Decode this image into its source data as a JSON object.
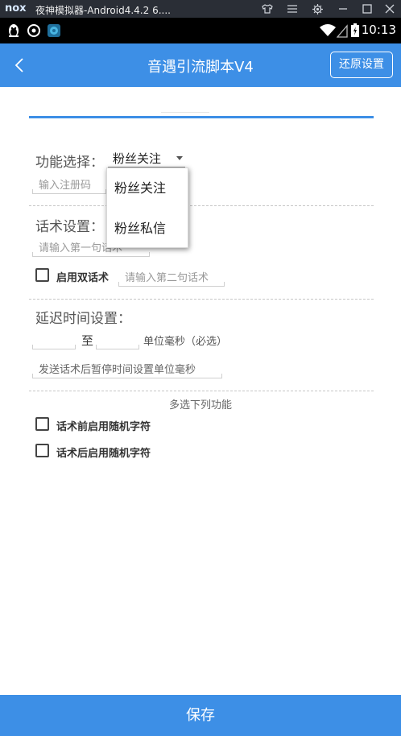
{
  "emulator": {
    "logo": "nox",
    "title": "夜神模拟器-Android4.4.2 6....",
    "controls": [
      "shirt-icon",
      "menu-icon",
      "gear-icon",
      "minimize-icon",
      "maximize-icon",
      "close-icon"
    ]
  },
  "status_bar": {
    "left_icons": [
      "qq-penguin-icon",
      "circle-app-icon",
      "round-app-icon"
    ],
    "right_icons": [
      "wifi-icon",
      "signal-icon",
      "battery-icon"
    ],
    "time": "10:13"
  },
  "header": {
    "title": "音遇引流脚本V4",
    "reset_label": "还原设置",
    "accent": "#3d8fe6"
  },
  "form": {
    "function_label": "功能选择：",
    "function_selected": "粉丝关注",
    "reg_code_placeholder": "输入注册码",
    "script_label": "话术设置：",
    "first_script_placeholder": "请输入第一句话术",
    "dual_script_label": "启用双话术",
    "dual_script_checked": false,
    "second_script_placeholder": "请输入第二句话术",
    "delay_label": "延迟时间设置：",
    "delay_from_value": "",
    "delay_to_label": "至",
    "delay_to_value": "",
    "delay_unit_label": "单位毫秒（必选）",
    "pause_placeholder": "发送话术后暂停时间设置单位毫秒",
    "multi_caption": "多选下列功能",
    "random_before_label": "话术前启用随机字符",
    "random_before_checked": false,
    "random_after_label": "话术后启用随机字符",
    "random_after_checked": false
  },
  "dropdown": {
    "options": [
      "粉丝关注",
      "粉丝私信"
    ]
  },
  "footer": {
    "save_label": "保存"
  }
}
